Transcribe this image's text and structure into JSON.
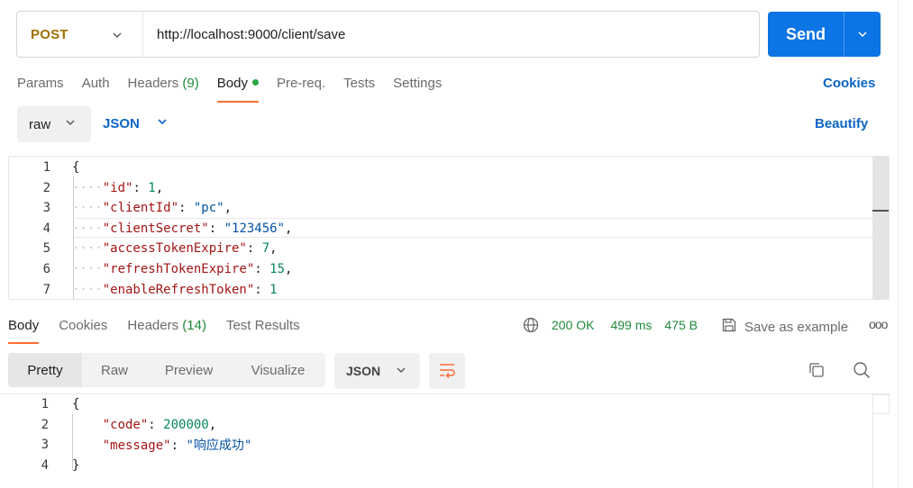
{
  "request": {
    "method": "POST",
    "url": "http://localhost:9000/client/save",
    "send_label": "Send"
  },
  "request_tabs": [
    {
      "label": "Params",
      "count": "",
      "active": false
    },
    {
      "label": "Auth",
      "count": "",
      "active": false
    },
    {
      "label": "Headers",
      "count": "(9)",
      "active": false
    },
    {
      "label": "Body",
      "count": "",
      "active": true
    },
    {
      "label": "Pre-req.",
      "count": "",
      "active": false
    },
    {
      "label": "Tests",
      "count": "",
      "active": false
    },
    {
      "label": "Settings",
      "count": "",
      "active": false
    }
  ],
  "cookies_label": "Cookies",
  "body_options": {
    "mode": "raw",
    "language": "JSON",
    "beautify_label": "Beautify"
  },
  "request_body_lines": [
    {
      "n": "1",
      "indent": "",
      "key": "",
      "value": "",
      "vtype": "",
      "text": "{"
    },
    {
      "n": "2",
      "indent": "····",
      "key": "\"id\"",
      "value": "1",
      "vtype": "n",
      "trail": ","
    },
    {
      "n": "3",
      "indent": "····",
      "key": "\"clientId\"",
      "value": "\"pc\"",
      "vtype": "s",
      "trail": ","
    },
    {
      "n": "4",
      "indent": "····",
      "key": "\"clientSecret\"",
      "value": "\"123456\"",
      "vtype": "s",
      "trail": ","
    },
    {
      "n": "5",
      "indent": "····",
      "key": "\"accessTokenExpire\"",
      "value": "7",
      "vtype": "n",
      "trail": ","
    },
    {
      "n": "6",
      "indent": "····",
      "key": "\"refreshTokenExpire\"",
      "value": "15",
      "vtype": "n",
      "trail": ","
    },
    {
      "n": "7",
      "indent": "····",
      "key": "\"enableRefreshToken\"",
      "value": "1",
      "vtype": "n",
      "trail": ""
    }
  ],
  "response_tabs": [
    {
      "label": "Body",
      "count": "",
      "active": true
    },
    {
      "label": "Cookies",
      "count": "",
      "active": false
    },
    {
      "label": "Headers",
      "count": "(14)",
      "active": false
    },
    {
      "label": "Test Results",
      "count": "",
      "active": false
    }
  ],
  "response_status": {
    "status": "200 OK",
    "time": "499 ms",
    "size": "475 B",
    "save_label": "Save as example",
    "more": "ooo"
  },
  "response_views": [
    "Pretty",
    "Raw",
    "Preview",
    "Visualize"
  ],
  "response_format": "JSON",
  "response_body_lines": [
    {
      "n": "1",
      "key": "",
      "value": "",
      "vtype": "",
      "text": "{"
    },
    {
      "n": "2",
      "key": "\"code\"",
      "value": "200000",
      "vtype": "n",
      "trail": ","
    },
    {
      "n": "3",
      "key": "\"message\"",
      "value": "\"响应成功\"",
      "vtype": "s",
      "trail": ""
    },
    {
      "n": "4",
      "key": "",
      "value": "",
      "vtype": "",
      "text": "}"
    }
  ],
  "colors": {
    "send_button": "#0c74e4",
    "method_post": "#a07000",
    "link_blue": "#0c64c4",
    "active_tab_underline": "#ff6c37",
    "status_green": "#1f8a3a",
    "json_key": "#a31515",
    "json_string": "#0451a5",
    "json_number": "#098658"
  },
  "icons": [
    "chevron-down-icon",
    "green-dot-icon",
    "globe-icon",
    "save-icon",
    "more-icon",
    "wrap-lines-icon",
    "copy-icon",
    "search-icon"
  ]
}
